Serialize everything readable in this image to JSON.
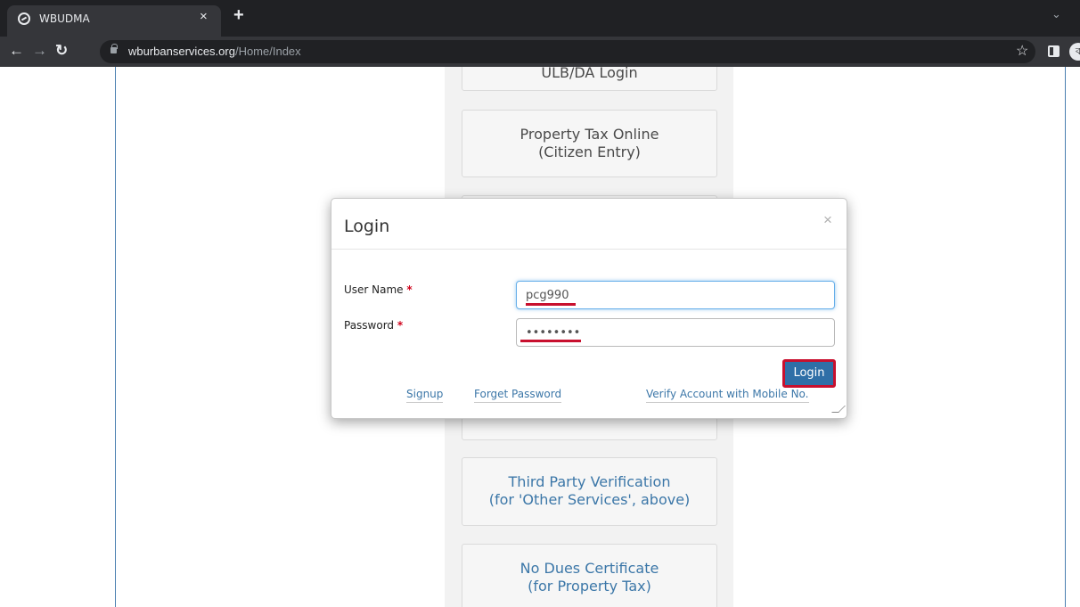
{
  "browser": {
    "tab_title": "WBUDMA",
    "tab_close": "×",
    "new_tab": "+",
    "url_domain": "wburbanservices.org",
    "url_path": "/Home/Index",
    "profile_initial": "ব"
  },
  "page": {
    "tiles": [
      {
        "line1": "ULB/DA Login",
        "line2": ""
      },
      {
        "line1": "Property Tax Online",
        "line2": "(Citizen Entry)"
      },
      {
        "line1": "Third Party Verification",
        "line2": "(for 'Other Services', above)"
      },
      {
        "line1": "No Dues Certificate",
        "line2": "(for Property Tax)"
      }
    ]
  },
  "modal": {
    "title": "Login",
    "close": "×",
    "username_label": "User Name",
    "password_label": "Password",
    "required_mark": "*",
    "username_value": "pcg990",
    "password_value": "••••••••",
    "login_button": "Login",
    "links": {
      "signup": "Signup",
      "forget_password": "Forget Password",
      "verify_account": "Verify Account with Mobile No."
    }
  },
  "colors": {
    "accent": "#2f6fa7",
    "highlight": "#c8102e",
    "link": "#3c77a8"
  }
}
